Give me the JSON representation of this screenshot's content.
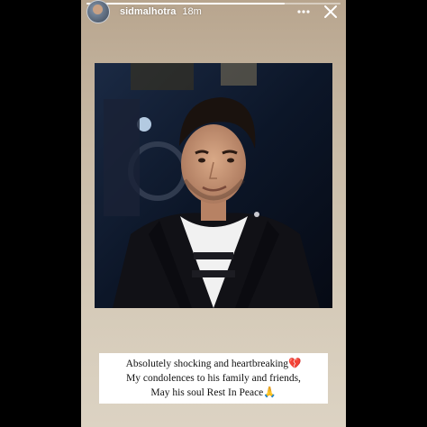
{
  "story": {
    "username": "sidmalhotra",
    "time": "18m",
    "progress": 0.78,
    "more_icon": "more-horizontal-icon",
    "close_icon": "close-icon",
    "caption_lines": [
      "Absolutely shocking and heartbreaking💔",
      "My condolences to his family and friends,",
      "May his soul Rest In Peace🙏"
    ]
  }
}
